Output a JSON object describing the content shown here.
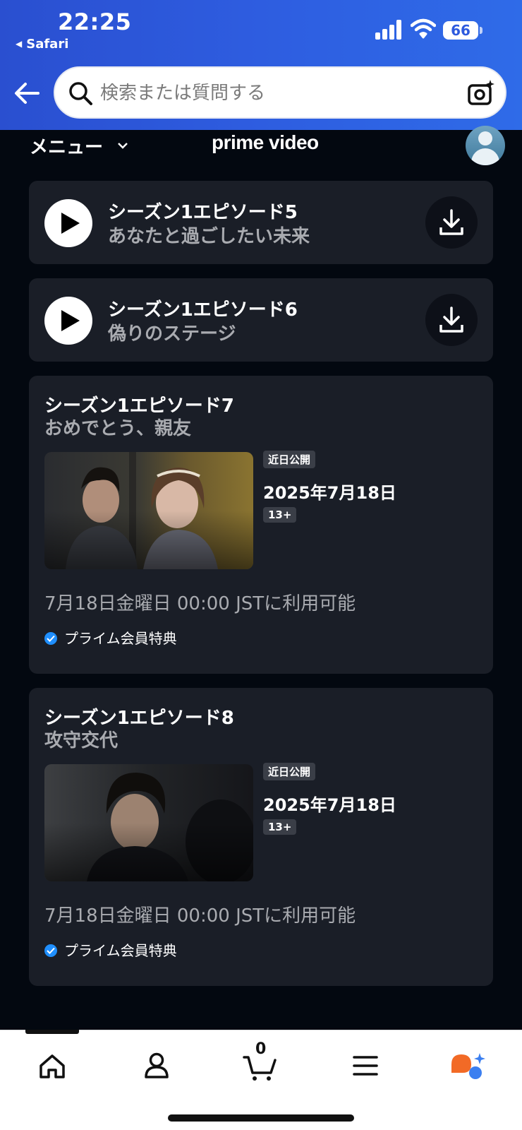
{
  "status_bar": {
    "time": "22:25",
    "back_app": "Safari",
    "battery": "66"
  },
  "search": {
    "placeholder": "検索または質問する"
  },
  "nav": {
    "menu_label": "メニュー",
    "logo": "prime video"
  },
  "episodes_compact": [
    {
      "title": "シーズン1エピソード5",
      "subtitle": "あなたと過ごしたい未来"
    },
    {
      "title": "シーズン1エピソード6",
      "subtitle": "偽りのステージ"
    }
  ],
  "episodes_upcoming": [
    {
      "title": "シーズン1エピソード7",
      "subtitle": "おめでとう、親友",
      "badge": "近日公開",
      "release_date": "2025年7月18日",
      "rating": "13+",
      "availability": "7月18日金曜日 00:00 JSTに利用可能",
      "benefit": "プライム会員特典"
    },
    {
      "title": "シーズン1エピソード8",
      "subtitle": "攻守交代",
      "badge": "近日公開",
      "release_date": "2025年7月18日",
      "rating": "13+",
      "availability": "7月18日金曜日 00:00 JSTに利用可能",
      "benefit": "プライム会員特典"
    }
  ],
  "tabbar": {
    "cart_count": "0"
  },
  "icons": [
    "back-arrow-icon",
    "search-icon",
    "camera-icon",
    "chevron-down-icon",
    "play-icon",
    "download-icon",
    "check-icon",
    "home-icon",
    "account-icon",
    "cart-icon",
    "menu-icon",
    "rufus-icon"
  ]
}
